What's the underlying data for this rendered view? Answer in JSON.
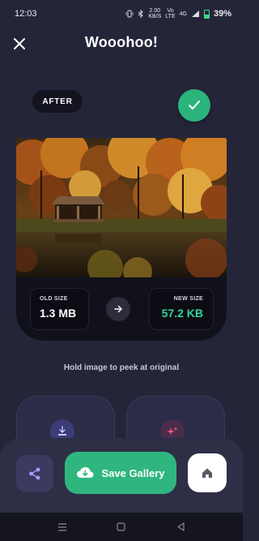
{
  "status": {
    "time": "12:03",
    "net_speed_value": "2.00",
    "net_speed_unit": "KB/S",
    "volte_top": "Vo",
    "volte_bottom": "LTE",
    "signal": "4G",
    "battery": "39%"
  },
  "header": {
    "title": "Wooohoo!",
    "close_icon": "close-icon"
  },
  "card": {
    "badge": "AFTER",
    "old_size_label": "OLD SIZE",
    "old_size_value": "1.3 MB",
    "new_size_label": "NEW SIZE",
    "new_size_value": "57.2 KB"
  },
  "hint": "Hold image to peek at original",
  "actions": {
    "save_label": "Save Gallery",
    "share_icon": "share-icon",
    "home_icon": "home-icon"
  },
  "colors": {
    "accent": "#2fb67f",
    "new_size": "#35d39a",
    "background": "#25253a"
  }
}
